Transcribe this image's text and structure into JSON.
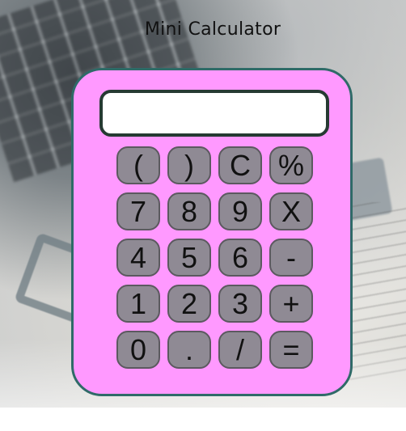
{
  "title": "Mini Calculator",
  "display": {
    "value": ""
  },
  "keys": [
    [
      "(",
      ")",
      "C",
      "%"
    ],
    [
      "7",
      "8",
      "9",
      "X"
    ],
    [
      "4",
      "5",
      "6",
      "-"
    ],
    [
      "1",
      "2",
      "3",
      "+"
    ],
    [
      "0",
      ".",
      "/",
      "="
    ]
  ],
  "colors": {
    "body": "#ff99ff",
    "body_border": "#2f6a68",
    "key": "#8f8a94",
    "display_border": "#263a33"
  }
}
